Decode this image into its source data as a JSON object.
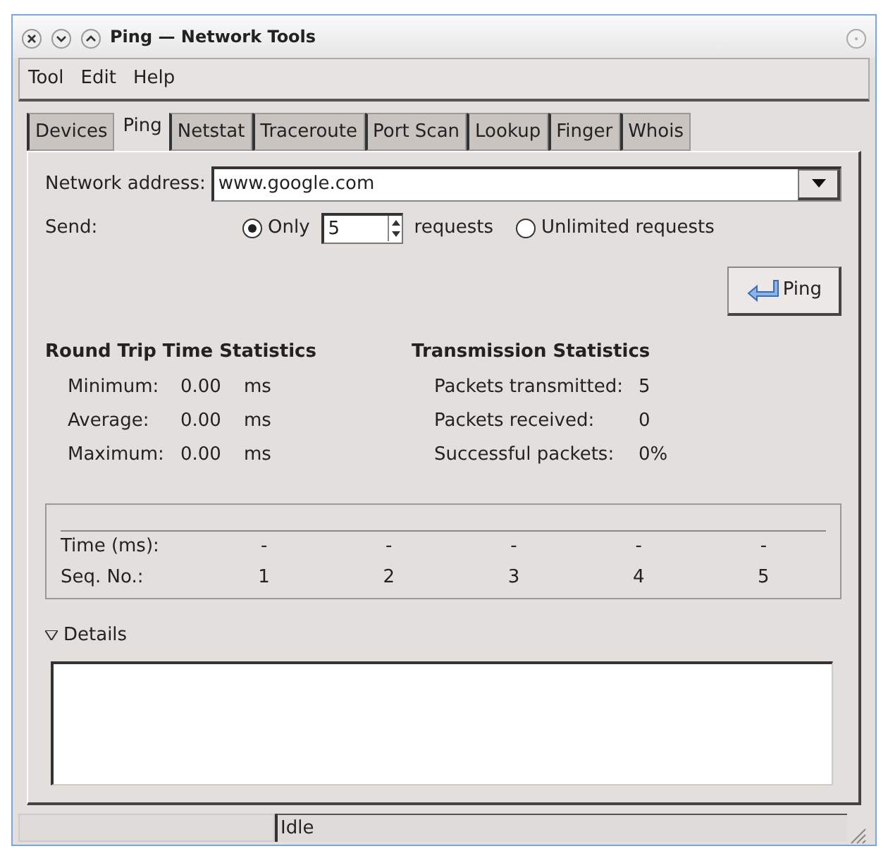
{
  "window": {
    "title": "Ping — Network Tools"
  },
  "menu": [
    "Tool",
    "Edit",
    "Help"
  ],
  "tabs": [
    {
      "label": "Devices",
      "selected": false
    },
    {
      "label": "Ping",
      "selected": true
    },
    {
      "label": "Netstat",
      "selected": false
    },
    {
      "label": "Traceroute",
      "selected": false
    },
    {
      "label": "Port Scan",
      "selected": false
    },
    {
      "label": "Lookup",
      "selected": false
    },
    {
      "label": "Finger",
      "selected": false
    },
    {
      "label": "Whois",
      "selected": false
    }
  ],
  "address": {
    "label": "Network address:",
    "value": "www.google.com"
  },
  "send": {
    "label": "Send:",
    "options": [
      {
        "label": "Only",
        "selected": true
      },
      {
        "label": "Unlimited requests",
        "selected": false
      }
    ],
    "count": "5",
    "suffix": "requests"
  },
  "ping_button": "Ping",
  "rtt": {
    "title": "Round Trip Time Statistics",
    "rows": [
      {
        "label": "Minimum:",
        "value": "0.00",
        "unit": "ms"
      },
      {
        "label": "Average:",
        "value": "0.00",
        "unit": "ms"
      },
      {
        "label": "Maximum:",
        "value": "0.00",
        "unit": "ms"
      }
    ]
  },
  "transmission": {
    "title": "Transmission Statistics",
    "rows": [
      {
        "label": "Packets transmitted:",
        "value": "5"
      },
      {
        "label": "Packets received:",
        "value": "0"
      },
      {
        "label": "Successful packets:",
        "value": "0%"
      }
    ]
  },
  "results": {
    "rows": [
      {
        "label": "Time (ms):",
        "cells": [
          "-",
          "-",
          "-",
          "-",
          "-"
        ]
      },
      {
        "label": "Seq. No.:",
        "cells": [
          "1",
          "2",
          "3",
          "4",
          "5"
        ]
      }
    ]
  },
  "details": {
    "label": "Details",
    "expanded": true
  },
  "status_bar": {
    "text": "Idle"
  }
}
